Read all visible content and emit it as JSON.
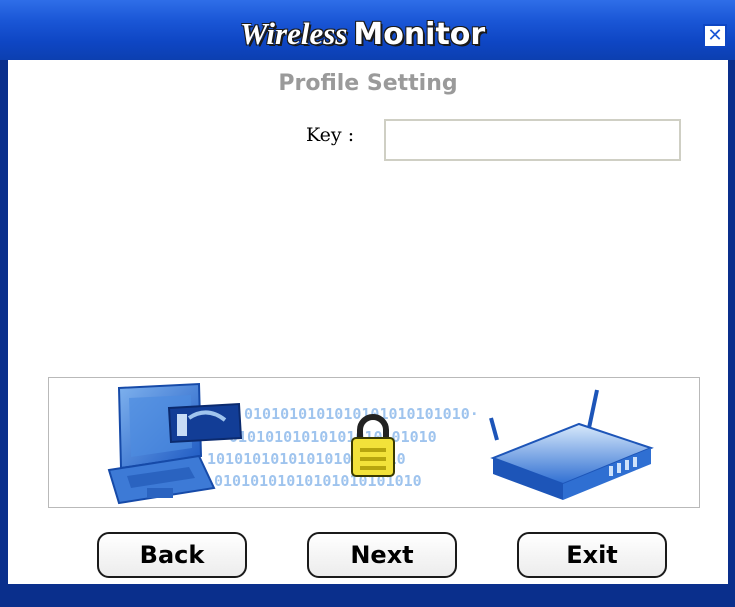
{
  "window": {
    "title_part1": "Wireless",
    "title_part2": "Monitor",
    "close_glyph": "✕"
  },
  "page": {
    "subtitle": "Profile Setting",
    "key_label": "Key :",
    "key_value": ""
  },
  "banner": {
    "binary_rows": [
      "0101010101010101010101010·",
      "01010101010101010101010",
      "1010101010101010101010",
      "01010101010101010101010"
    ],
    "icons": [
      "laptop-icon",
      "padlock-icon",
      "router-icon"
    ]
  },
  "buttons": {
    "back": "Back",
    "next": "Next",
    "exit": "Exit"
  },
  "colors": {
    "titlebar": "#1a56d6",
    "frame": "#0a2f8c",
    "subtitle": "#9a9a9a",
    "binary": "#9fc4ee",
    "binary_bold": "#1f4aa6"
  }
}
